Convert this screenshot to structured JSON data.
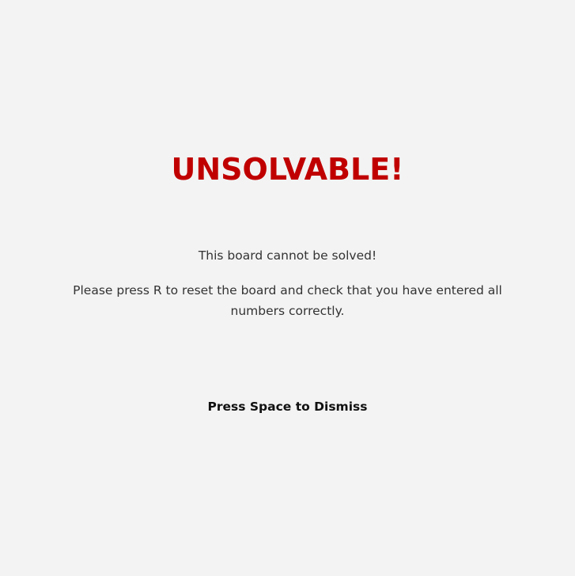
{
  "dialog": {
    "title": "UNSOLVABLE!",
    "message": "This board cannot be solved!",
    "instructions": "Please press R to reset the board and check that you have  entered all numbers correctly.",
    "dismiss_hint": "Press Space to Dismiss"
  },
  "colors": {
    "background": "#f3f3f3",
    "title": "#c00000",
    "text": "#333333",
    "dismiss": "#111111"
  }
}
